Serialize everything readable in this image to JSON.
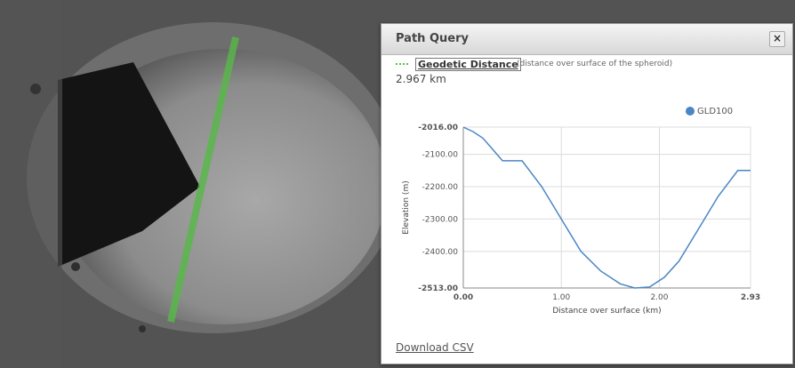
{
  "panel": {
    "title": "Path Query",
    "close_label": "×",
    "measure_label": "Geodetic Distance",
    "measure_note": "(distance over surface of the spheroid)",
    "distance_value": "2.967 km",
    "download_label": "Download CSV"
  },
  "chart_data": {
    "type": "line",
    "xlabel": "Distance over surface (km)",
    "ylabel": "Elevation (m)",
    "xlim": [
      0,
      2.93
    ],
    "ylim": [
      -2513,
      -2016
    ],
    "x_ticks": [
      "0.00",
      "1.00",
      "2.00",
      "2.93"
    ],
    "y_ticks": [
      "-2016.00",
      "-2100.00",
      "-2200.00",
      "-2300.00",
      "-2400.00",
      "-2513.00"
    ],
    "legend": "top-right",
    "series": [
      {
        "name": "GLD100",
        "color": "#4a86c5",
        "x": [
          0,
          0.1,
          0.2,
          0.3,
          0.4,
          0.6,
          0.8,
          1.0,
          1.2,
          1.4,
          1.6,
          1.75,
          1.9,
          2.05,
          2.2,
          2.4,
          2.6,
          2.8,
          2.93
        ],
        "y": [
          -2016,
          -2030,
          -2050,
          -2085,
          -2120,
          -2120,
          -2200,
          -2300,
          -2400,
          -2460,
          -2500,
          -2513,
          -2510,
          -2480,
          -2430,
          -2330,
          -2230,
          -2150,
          -2150
        ]
      }
    ]
  }
}
